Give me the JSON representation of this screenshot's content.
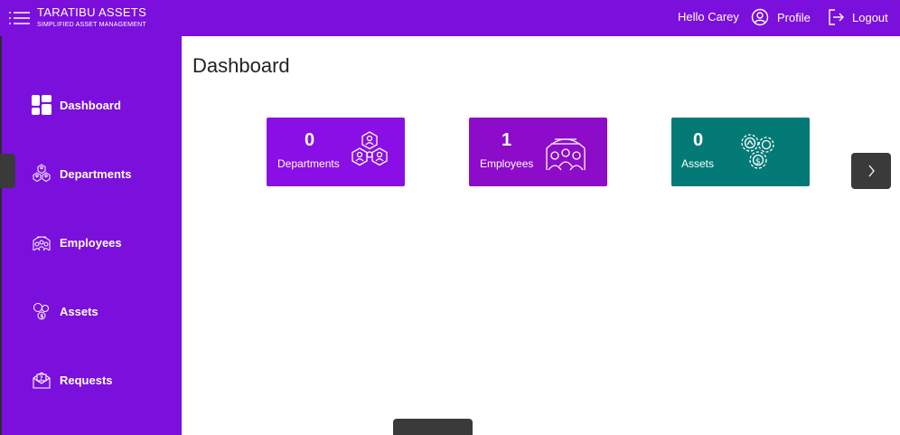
{
  "header": {
    "brand_title": "TARATIBU ASSETS",
    "brand_subtitle": "SIMPLIFIED ASSET MANAGEMENT",
    "greeting": "Hello Carey",
    "profile_label": "Profile",
    "logout_label": "Logout",
    "color": "#7b0fdc"
  },
  "sidebar": {
    "items": [
      {
        "label": "Dashboard",
        "icon": "dashboard-icon"
      },
      {
        "label": "Departments",
        "icon": "departments-icon"
      },
      {
        "label": "Employees",
        "icon": "employees-icon"
      },
      {
        "label": "Assets",
        "icon": "assets-icon"
      },
      {
        "label": "Requests",
        "icon": "requests-icon"
      }
    ]
  },
  "main": {
    "title": "Dashboard",
    "cards": [
      {
        "count": "0",
        "label": "Departments",
        "color": "#8a0fe6",
        "icon": "departments-icon"
      },
      {
        "count": "1",
        "label": "Employees",
        "color": "#8c0cc9",
        "icon": "employees-icon"
      },
      {
        "count": "0",
        "label": "Assets",
        "color": "#047a77",
        "icon": "assets-icon"
      }
    ],
    "next_icon": "chevron-right-icon"
  }
}
